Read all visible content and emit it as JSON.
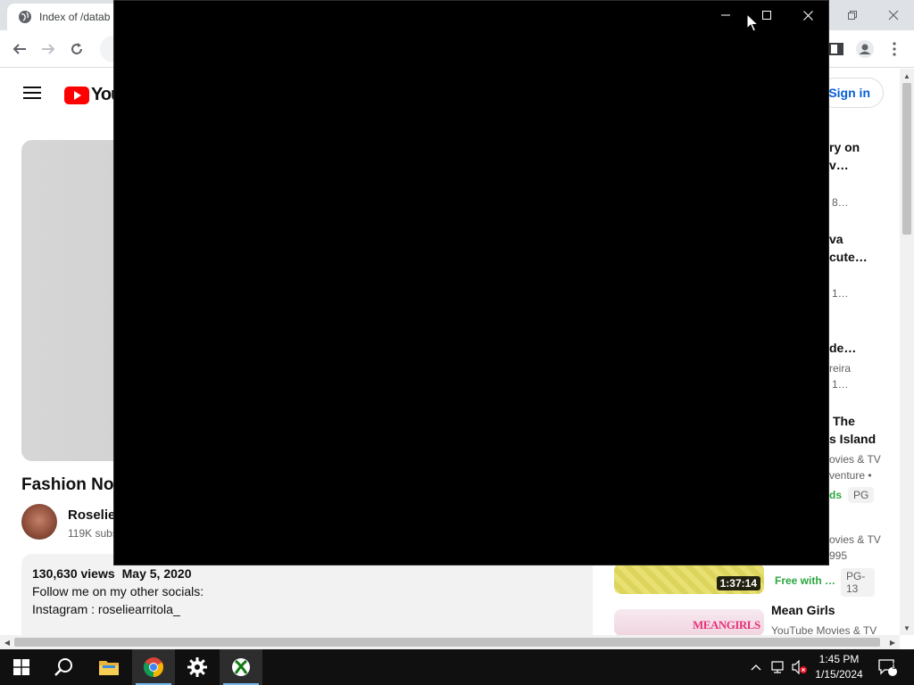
{
  "browser": {
    "tab_title": "Index of /datab",
    "icons": {
      "back": "arrow-left-icon",
      "forward": "arrow-right-icon",
      "reload": "reload-icon",
      "sidepanel": "side-panel-icon",
      "profile": "profile-icon",
      "menu": "kebab-menu-icon"
    }
  },
  "youtube": {
    "logo_text": "You",
    "signin_label": "Sign in",
    "video_title": "Fashion Nov",
    "channel_name": "Roselie",
    "subscribers": "119K subs",
    "description": {
      "views": "130,630 views",
      "date": "May 5, 2020",
      "line1": "Follow me on my other socials:",
      "line2": "Instagram : roseliearritola_"
    },
    "recommendations": {
      "r1_title_a": "ry on",
      "r1_title_b": "v…",
      "r1_meta": "8…",
      "r2_title_a": "va",
      "r2_title_b": "cute…",
      "r2_meta": "1…",
      "r3_title": "de…",
      "r3_channel": "reira",
      "r3_meta": "1…",
      "r4_title_a": "The",
      "r4_title_b": "s Island",
      "r4_channel": "ovies & TV",
      "r4_genre": "venture •",
      "r4_free": "ds",
      "r4_rating": "PG",
      "r5_channel": "ovies & TV",
      "r5_year": "995",
      "r5_duration": "1:37:14",
      "r5_free": "Free with …",
      "r5_rating": "PG-13",
      "r6_title": "Mean Girls",
      "r6_channel": "YouTube Movies & TV",
      "r6_thumb_text": "MEANGIRLS"
    }
  },
  "taskbar": {
    "time": "1:45 PM",
    "date": "1/15/2024",
    "notifications": "3",
    "apps": [
      "start-icon",
      "search-icon",
      "file-explorer-icon",
      "chrome-icon",
      "settings-icon",
      "xbox-icon"
    ]
  },
  "colors": {
    "youtube_red": "#ff0000",
    "link_blue": "#065fd4",
    "free_green": "#2ba640",
    "taskbar": "#101010",
    "overlay": "#000000"
  }
}
